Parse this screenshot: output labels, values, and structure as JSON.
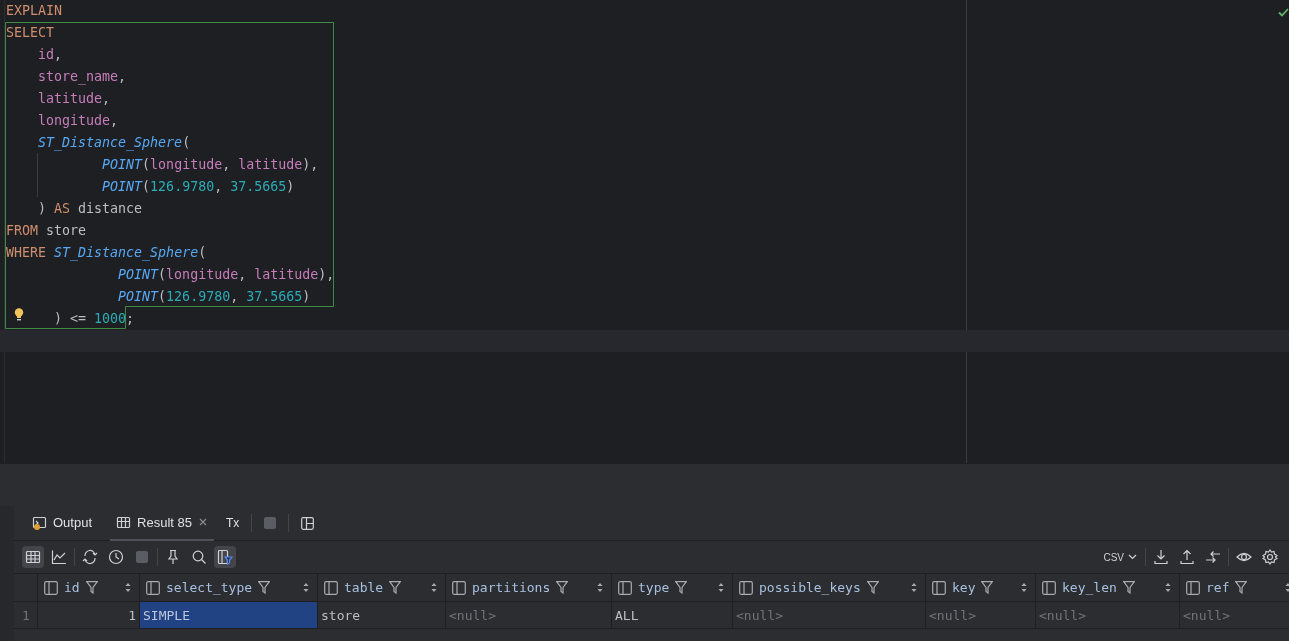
{
  "editor": {
    "lines": [
      {
        "current": false,
        "tokens": [
          {
            "text": "EXPLAIN",
            "kind": "keyword"
          }
        ]
      },
      {
        "current": false,
        "tokens": [
          {
            "text": "SELECT",
            "kind": "keyword"
          }
        ]
      },
      {
        "current": false,
        "tokens": [
          {
            "text": "    id",
            "kind": "field"
          },
          {
            "text": ",",
            "kind": "plain"
          }
        ]
      },
      {
        "current": false,
        "tokens": [
          {
            "text": "    store_name",
            "kind": "field"
          },
          {
            "text": ",",
            "kind": "plain"
          }
        ]
      },
      {
        "current": false,
        "tokens": [
          {
            "text": "    latitude",
            "kind": "field"
          },
          {
            "text": ",",
            "kind": "plain"
          }
        ]
      },
      {
        "current": false,
        "tokens": [
          {
            "text": "    longitude",
            "kind": "field"
          },
          {
            "text": ",",
            "kind": "plain"
          }
        ]
      },
      {
        "current": false,
        "tokens": [
          {
            "text": "    ST_Distance_Sphere",
            "kind": "function"
          },
          {
            "text": "(",
            "kind": "plain"
          }
        ]
      },
      {
        "current": false,
        "tokens": [
          {
            "text": "            POINT",
            "kind": "function"
          },
          {
            "text": "(",
            "kind": "plain"
          },
          {
            "text": "longitude",
            "kind": "field"
          },
          {
            "text": ", ",
            "kind": "plain"
          },
          {
            "text": "latitude",
            "kind": "field"
          },
          {
            "text": "),",
            "kind": "plain"
          }
        ]
      },
      {
        "current": false,
        "tokens": [
          {
            "text": "            POINT",
            "kind": "function"
          },
          {
            "text": "(",
            "kind": "plain"
          },
          {
            "text": "126.9780",
            "kind": "number"
          },
          {
            "text": ", ",
            "kind": "plain"
          },
          {
            "text": "37.5665",
            "kind": "number"
          },
          {
            "text": ")",
            "kind": "plain"
          }
        ]
      },
      {
        "current": false,
        "tokens": [
          {
            "text": "    ) ",
            "kind": "plain"
          },
          {
            "text": "AS",
            "kind": "keyword"
          },
          {
            "text": " distance",
            "kind": "plain"
          }
        ]
      },
      {
        "current": false,
        "tokens": [
          {
            "text": "FROM",
            "kind": "keyword"
          },
          {
            "text": " store",
            "kind": "plain"
          }
        ]
      },
      {
        "current": false,
        "tokens": [
          {
            "text": "WHERE ",
            "kind": "keyword"
          },
          {
            "text": "ST_Distance_Sphere",
            "kind": "function"
          },
          {
            "text": "(",
            "kind": "plain"
          }
        ]
      },
      {
        "current": false,
        "tokens": [
          {
            "text": "              POINT",
            "kind": "function"
          },
          {
            "text": "(",
            "kind": "plain"
          },
          {
            "text": "longitude",
            "kind": "field"
          },
          {
            "text": ", ",
            "kind": "plain"
          },
          {
            "text": "latitude",
            "kind": "field"
          },
          {
            "text": "),",
            "kind": "plain"
          }
        ]
      },
      {
        "current": false,
        "tokens": [
          {
            "text": "              POINT",
            "kind": "function"
          },
          {
            "text": "(",
            "kind": "plain"
          },
          {
            "text": "126.9780",
            "kind": "number"
          },
          {
            "text": ", ",
            "kind": "plain"
          },
          {
            "text": "37.5665",
            "kind": "number"
          },
          {
            "text": ")",
            "kind": "plain"
          }
        ]
      },
      {
        "current": false,
        "tokens": [
          {
            "text": "      ) <= ",
            "kind": "plain"
          },
          {
            "text": "1000",
            "kind": "number"
          },
          {
            "text": ";",
            "kind": "plain"
          }
        ]
      },
      {
        "current": true
      }
    ]
  },
  "tabs": [
    {
      "label": "Output",
      "kind": "output",
      "selected": false
    },
    {
      "label": "Result 85",
      "kind": "result",
      "selected": true
    }
  ],
  "tx_button": "Tx",
  "toolbar": {
    "buttons": [
      {
        "kind": "table",
        "selected": true
      },
      {
        "kind": "chart",
        "selected": false
      },
      {
        "kind": "sep"
      },
      {
        "kind": "refresh",
        "selected": false
      },
      {
        "kind": "history",
        "selected": false
      },
      {
        "kind": "stop",
        "selected": false
      },
      {
        "kind": "sep"
      },
      {
        "kind": "pin",
        "selected": false
      },
      {
        "kind": "search",
        "selected": false
      },
      {
        "kind": "filter",
        "selected": true
      }
    ],
    "format": "CSV"
  },
  "grid": {
    "columns": [
      {
        "name": "id"
      },
      {
        "name": "select_type"
      },
      {
        "name": "table"
      },
      {
        "name": "partitions"
      },
      {
        "name": "type"
      },
      {
        "name": "possible_keys"
      },
      {
        "name": "key"
      },
      {
        "name": "key_len"
      },
      {
        "name": "ref"
      }
    ],
    "rows": [
      {
        "number": "1",
        "cells": [
          {
            "text": "1",
            "kind": "number",
            "selected": false
          },
          {
            "text": "SIMPLE",
            "kind": "text",
            "selected": true
          },
          {
            "text": "store",
            "kind": "text",
            "selected": false
          },
          {
            "text": "<null>",
            "kind": "null",
            "selected": false
          },
          {
            "text": "ALL",
            "kind": "text",
            "selected": false
          },
          {
            "text": "<null>",
            "kind": "null",
            "selected": false
          },
          {
            "text": "<null>",
            "kind": "null",
            "selected": false
          },
          {
            "text": "<null>",
            "kind": "null",
            "selected": false
          },
          {
            "text": "<null>",
            "kind": "null",
            "selected": false
          }
        ]
      }
    ]
  }
}
